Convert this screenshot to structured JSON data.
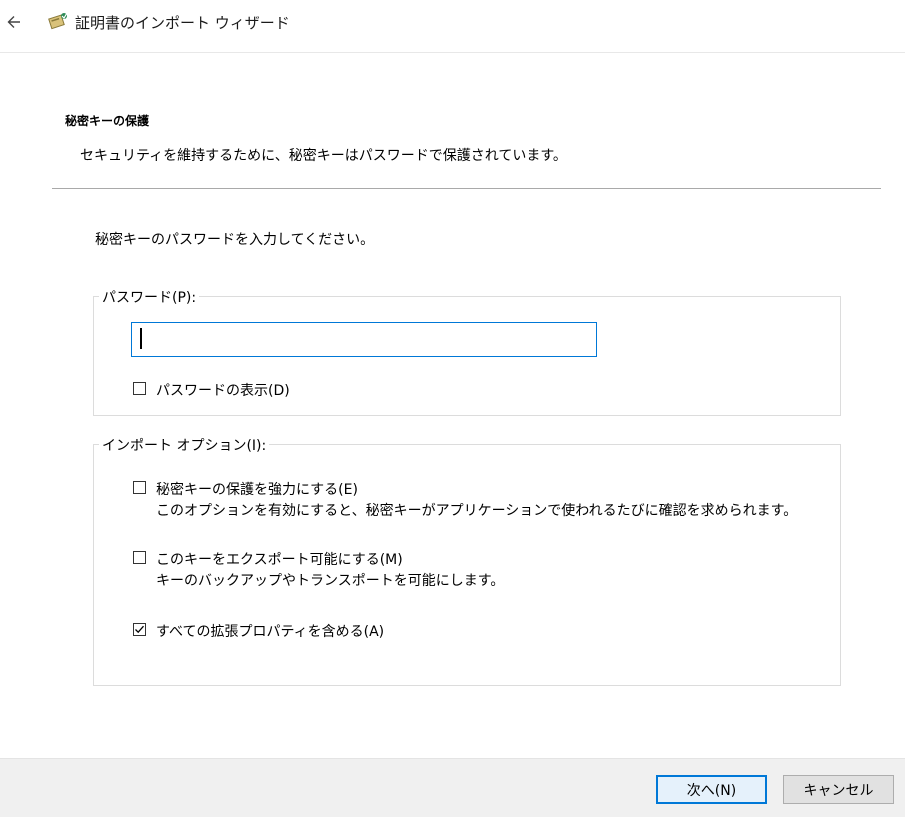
{
  "window": {
    "title": "証明書のインポート ウィザード",
    "back_icon": "arrow-left-icon",
    "app_icon": "certificate-wizard-icon"
  },
  "page": {
    "section_title": "秘密キーの保護",
    "section_description": "セキュリティを維持するために、秘密キーはパスワードで保護されています。",
    "prompt": "秘密キーのパスワードを入力してください。"
  },
  "password_group": {
    "legend": "パスワード(P):",
    "input_value": "",
    "show_password": {
      "label": "パスワードの表示(D)",
      "checked": false
    }
  },
  "import_options": {
    "legend": "インポート オプション(I):",
    "options": [
      {
        "label": "秘密キーの保護を強力にする(E)",
        "description": "このオプションを有効にすると、秘密キーがアプリケーションで使われるたびに確認を求められます。",
        "checked": false
      },
      {
        "label": "このキーをエクスポート可能にする(M)",
        "description": "キーのバックアップやトランスポートを可能にします。",
        "checked": false
      },
      {
        "label": "すべての拡張プロパティを含める(A)",
        "description": "",
        "checked": true
      }
    ]
  },
  "footer": {
    "next_label": "次へ(N)",
    "cancel_label": "キャンセル"
  },
  "colors": {
    "accent": "#0078d7",
    "footer_bg": "#f0f0f0",
    "divider": "#a9a9a9"
  }
}
